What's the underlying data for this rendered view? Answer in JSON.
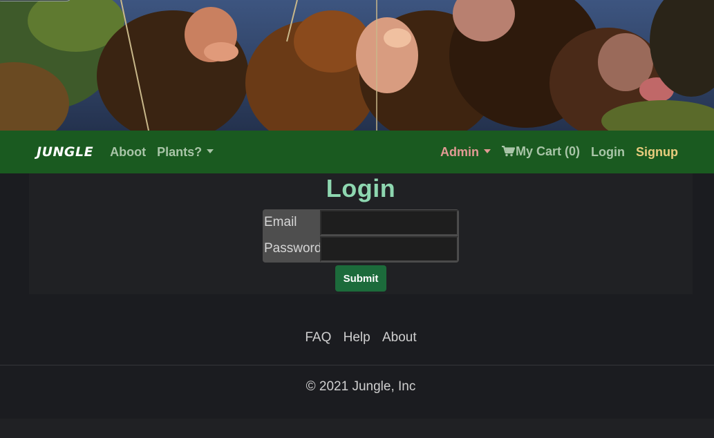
{
  "navbar": {
    "brand": "JUNGLE",
    "links": {
      "about": "Aboot",
      "plants": "Plants?",
      "admin": "Admin",
      "cart": "My Cart (0)",
      "login": "Login",
      "signup": "Signup"
    }
  },
  "login": {
    "title": "Login",
    "email_label": "Email",
    "password_label": "Password",
    "email_value": "",
    "password_value": "",
    "submit_label": "Submit"
  },
  "footer": {
    "links": [
      "FAQ",
      "Help",
      "About"
    ],
    "copyright": "© 2021 Jungle, Inc"
  },
  "colors": {
    "navbar_bg": "#1a5a20",
    "title": "#8ed7b0",
    "admin_link": "#e29a94",
    "signup_link": "#e8cc7e",
    "submit_bg": "#1c6b3b",
    "page_bg": "#1b1c20"
  },
  "icons": {
    "cart": "shopping-cart-icon",
    "dropdown": "chevron-down-icon"
  }
}
